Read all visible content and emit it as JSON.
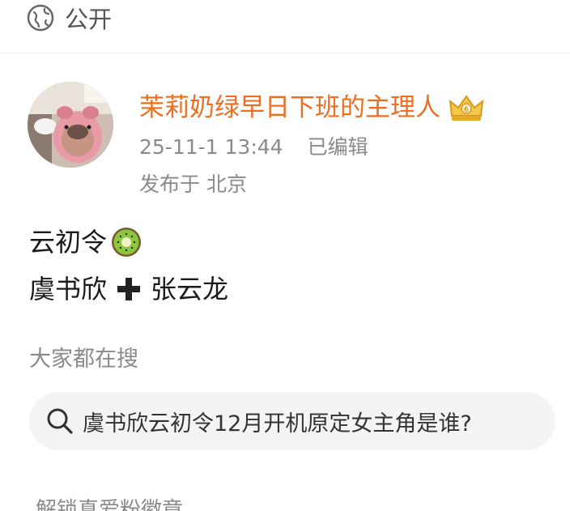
{
  "visibility": {
    "label": "公开",
    "icon": "globe-icon"
  },
  "author": {
    "name": "茉莉奶绿早日下班的主理人",
    "badge_icon": "crown-badge-icon",
    "timestamp": "25-11-1 13:44",
    "edited": "已编辑",
    "location": "发布于 北京"
  },
  "post": {
    "line1": "云初令",
    "line1_emoji": "kiwi-icon",
    "line2_a": "虞书欣",
    "line2_emoji": "plus-icon",
    "line2_b": "张云龙"
  },
  "search_section": {
    "title": "大家都在搜",
    "query": "虞书欣云初令12月开机原定女主角是谁?"
  },
  "footer_cut": {
    "label": "解锁真爱粉徽章"
  },
  "colors": {
    "username": "#ee6d1f",
    "muted": "#8a8a8a",
    "pill": "#f4f4f4"
  }
}
